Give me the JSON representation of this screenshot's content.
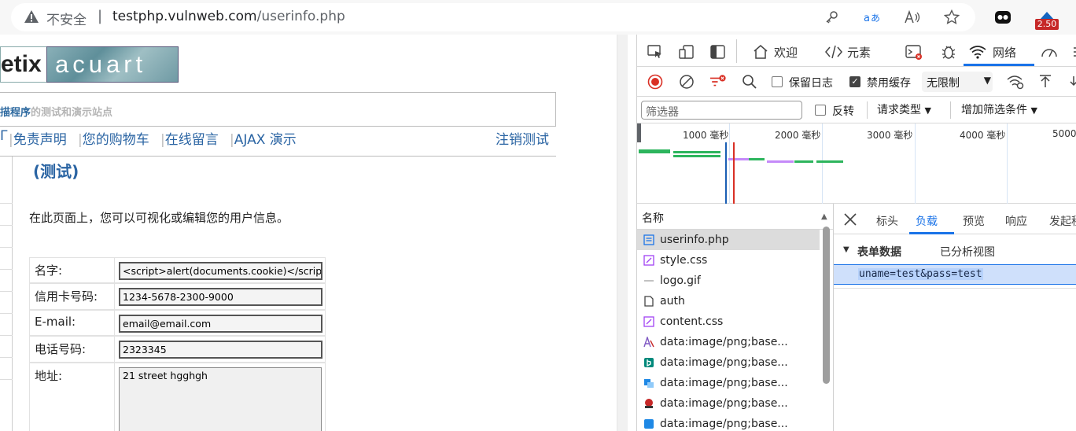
{
  "browser": {
    "insecure_label": "不安全",
    "separator": "|",
    "url_host": "testphp.vulnweb.com",
    "url_path": "/userinfo.php",
    "extension_badge": "2.50"
  },
  "page": {
    "logo_left": "etix",
    "logo_right": "acuart",
    "tagline_blue": "描程序",
    "tagline_rest": "的测试和演示站点",
    "nav": [
      {
        "label": "Γ"
      },
      {
        "label": "免责声明"
      },
      {
        "label": "您的购物车"
      },
      {
        "label": "在线留言"
      },
      {
        "label": "AJAX 演示"
      }
    ],
    "logout_label": "注销测试",
    "heading": "(测试)",
    "description": "在此页面上，您可以可视化或编辑您的用户信息。",
    "form": [
      {
        "label": "名字:",
        "value": "<script>alert(documents.cookie)</scrip"
      },
      {
        "label": "信用卡号码:",
        "value": "1234-5678-2300-9000"
      },
      {
        "label": "E-mail:",
        "value": "email@email.com"
      },
      {
        "label": "电话号码:",
        "value": "2323345"
      },
      {
        "label": "地址:",
        "value": "21 street hgghgh"
      }
    ]
  },
  "devtools": {
    "tabs": {
      "welcome": "欢迎",
      "elements": "元素",
      "network": "网络"
    },
    "toolbar": {
      "preserve_log": "保留日志",
      "disable_cache": "禁用缓存",
      "throttle": "无限制"
    },
    "filter": {
      "placeholder": "筛选器",
      "invert": "反转",
      "request_types": "请求类型",
      "more_filters": "增加筛选条件"
    },
    "timeline_labels": [
      "1000 毫秒",
      "2000 毫秒",
      "3000 毫秒",
      "4000 毫秒",
      "5000"
    ],
    "requests_header": "名称",
    "requests": [
      {
        "name": "userinfo.php",
        "icon": "document-icon",
        "color": "#1a73e8",
        "selected": true
      },
      {
        "name": "style.css",
        "icon": "stylesheet-icon",
        "color": "#a142f4"
      },
      {
        "name": "logo.gif",
        "icon": "image-icon",
        "color": "#888888"
      },
      {
        "name": "auth",
        "icon": "file-icon",
        "color": "#444444"
      },
      {
        "name": "content.css",
        "icon": "stylesheet-icon",
        "color": "#a142f4"
      },
      {
        "name": "data:image/png;base...",
        "icon": "image-icon",
        "color": "#7e57c2"
      },
      {
        "name": "data:image/png;base...",
        "icon": "image-icon",
        "color": "#00897b"
      },
      {
        "name": "data:image/png;base...",
        "icon": "image-icon",
        "color": "#1e88e5"
      },
      {
        "name": "data:image/png;base...",
        "icon": "image-icon",
        "color": "#c62828"
      },
      {
        "name": "data:image/png;base...",
        "icon": "image-icon",
        "color": "#1e88e5"
      }
    ],
    "detail_tabs": {
      "headers": "标头",
      "payload": "负载",
      "preview": "预览",
      "response": "响应",
      "initiator": "发起程"
    },
    "payload": {
      "section_title": "表单数据",
      "parsed_view": "已分析视图",
      "value": "uname=test&pass=test"
    }
  },
  "colors": {
    "accent": "#1a73e8",
    "link": "#2a64a3",
    "record_red": "#d93025"
  }
}
